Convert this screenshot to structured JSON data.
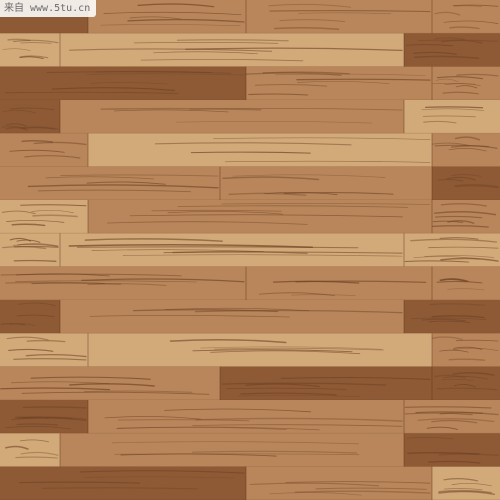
{
  "watermark": {
    "text": "来自 www.5tu.cn"
  },
  "palette": {
    "light": "#d2a978",
    "medium": "#b8865a",
    "dark": "#8e5a35",
    "grain": "#6e4326",
    "seam": "#5a3620"
  },
  "planks": [
    {
      "row": 0,
      "tone": "dark"
    },
    {
      "row": 0,
      "tone": "medium"
    },
    {
      "row": 0,
      "tone": "medium"
    },
    {
      "row": 0,
      "tone": "medium"
    },
    {
      "row": 1,
      "tone": "light"
    },
    {
      "row": 1,
      "tone": "light"
    },
    {
      "row": 1,
      "tone": "dark"
    },
    {
      "row": 2,
      "tone": "dark"
    },
    {
      "row": 2,
      "tone": "medium"
    },
    {
      "row": 2,
      "tone": "medium"
    },
    {
      "row": 3,
      "tone": "dark"
    },
    {
      "row": 3,
      "tone": "medium"
    },
    {
      "row": 3,
      "tone": "light"
    },
    {
      "row": 4,
      "tone": "medium"
    },
    {
      "row": 4,
      "tone": "light"
    },
    {
      "row": 4,
      "tone": "medium"
    },
    {
      "row": 5,
      "tone": "medium"
    },
    {
      "row": 5,
      "tone": "medium"
    },
    {
      "row": 5,
      "tone": "dark"
    },
    {
      "row": 6,
      "tone": "light"
    },
    {
      "row": 6,
      "tone": "medium"
    },
    {
      "row": 6,
      "tone": "medium"
    },
    {
      "row": 7,
      "tone": "light"
    },
    {
      "row": 7,
      "tone": "light"
    },
    {
      "row": 7,
      "tone": "light"
    },
    {
      "row": 8,
      "tone": "medium"
    },
    {
      "row": 8,
      "tone": "medium"
    },
    {
      "row": 8,
      "tone": "medium"
    },
    {
      "row": 9,
      "tone": "dark"
    },
    {
      "row": 9,
      "tone": "medium"
    },
    {
      "row": 9,
      "tone": "dark"
    },
    {
      "row": 10,
      "tone": "light"
    },
    {
      "row": 10,
      "tone": "light"
    },
    {
      "row": 10,
      "tone": "medium"
    },
    {
      "row": 11,
      "tone": "medium"
    },
    {
      "row": 11,
      "tone": "dark"
    },
    {
      "row": 11,
      "tone": "dark"
    },
    {
      "row": 12,
      "tone": "dark"
    },
    {
      "row": 12,
      "tone": "medium"
    },
    {
      "row": 12,
      "tone": "medium"
    },
    {
      "row": 13,
      "tone": "light"
    },
    {
      "row": 13,
      "tone": "medium"
    },
    {
      "row": 13,
      "tone": "dark"
    },
    {
      "row": 14,
      "tone": "dark"
    },
    {
      "row": 14,
      "tone": "medium"
    },
    {
      "row": 14,
      "tone": "light"
    }
  ]
}
